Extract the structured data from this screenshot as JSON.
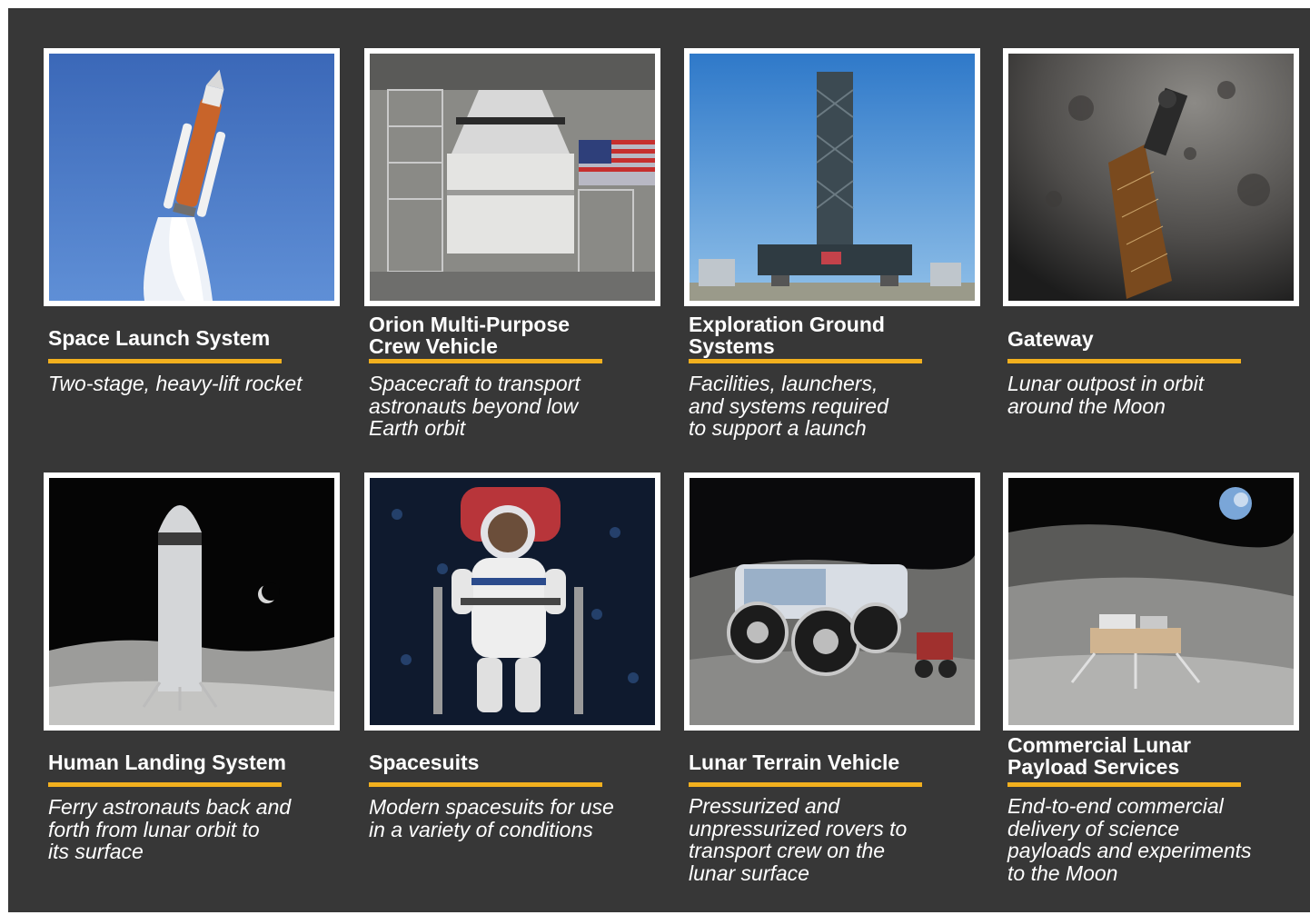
{
  "cards": [
    {
      "title": "Space Launch System",
      "desc": "Two-stage, heavy-lift rocket",
      "image_icon": "rocket-icon"
    },
    {
      "title": "Orion Multi-Purpose\nCrew Vehicle",
      "desc": "Spacecraft to transport\nastronauts beyond low\nEarth orbit",
      "image_icon": "capsule-icon"
    },
    {
      "title": "Exploration Ground\nSystems",
      "desc": "Facilities, launchers,\nand systems required\nto support a launch",
      "image_icon": "launch-tower-icon"
    },
    {
      "title": "Gateway",
      "desc": "Lunar outpost in orbit\naround the Moon",
      "image_icon": "space-station-icon"
    },
    {
      "title": "Human Landing System",
      "desc": "Ferry astronauts back and\nforth from lunar orbit to\nits surface",
      "image_icon": "lander-icon"
    },
    {
      "title": "Spacesuits",
      "desc": "Modern spacesuits for use\nin a variety of conditions",
      "image_icon": "spacesuit-icon"
    },
    {
      "title": "Lunar Terrain Vehicle",
      "desc": "Pressurized and\nunpressurized rovers to\ntransport crew on the\nlunar surface",
      "image_icon": "rover-icon"
    },
    {
      "title": "Commercial Lunar\nPayload Services",
      "desc": "End-to-end commercial\ndelivery of science\npayloads and experiments\nto the Moon",
      "image_icon": "payload-lander-icon"
    }
  ],
  "colors": {
    "background": "#373737",
    "accent": "#f2b01e",
    "text": "#ffffff"
  }
}
